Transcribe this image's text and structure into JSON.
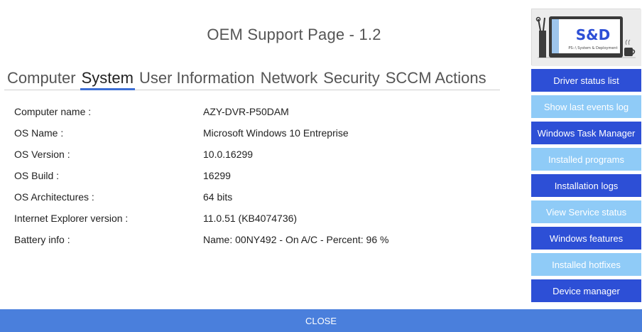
{
  "header": {
    "title": "OEM Support Page - 1.2"
  },
  "tabs": [
    {
      "label": "Computer",
      "active": false
    },
    {
      "label": "System",
      "active": true
    },
    {
      "label": "User Information",
      "active": false
    },
    {
      "label": "Network",
      "active": false
    },
    {
      "label": "Security",
      "active": false
    },
    {
      "label": "SCCM Actions",
      "active": false
    }
  ],
  "system_info": [
    {
      "label": "Computer name :",
      "value": "AZY-DVR-P50DAM"
    },
    {
      "label": "OS Name :",
      "value": "Microsoft Windows 10 Entreprise"
    },
    {
      "label": "OS Version :",
      "value": "10.0.16299"
    },
    {
      "label": "OS Build :",
      "value": "16299"
    },
    {
      "label": "OS Architectures :",
      "value": "64 bits"
    },
    {
      "label": "Internet Explorer version :",
      "value": "11.0.51 (KB4074736)"
    },
    {
      "label": "Battery info :",
      "value": "Name: 00NY492 - On A/C - Percent: 96 %"
    }
  ],
  "logo": {
    "text": "S&D",
    "subtitle": "PS::\\ System & Deployment"
  },
  "sidebar": {
    "buttons": [
      {
        "label": "Driver status list",
        "style": "dark"
      },
      {
        "label": "Show last events log",
        "style": "light"
      },
      {
        "label": "Windows Task Manager",
        "style": "dark"
      },
      {
        "label": "Installed programs",
        "style": "light"
      },
      {
        "label": "Installation logs",
        "style": "dark"
      },
      {
        "label": "View Service status",
        "style": "light"
      },
      {
        "label": "Windows features",
        "style": "dark"
      },
      {
        "label": "Installed hotfixes",
        "style": "light"
      },
      {
        "label": "Device manager",
        "style": "dark"
      }
    ]
  },
  "footer": {
    "close_label": "CLOSE"
  },
  "colors": {
    "dark_button": "#2d4fd6",
    "light_button": "#8fcbf7",
    "close_bar": "#4a7fdc",
    "tab_underline": "#3d6fd4"
  }
}
